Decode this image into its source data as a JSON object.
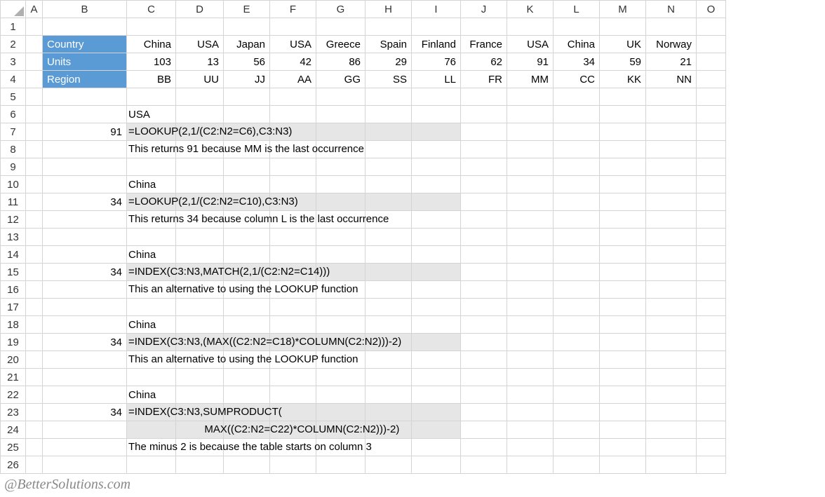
{
  "columns": [
    "A",
    "B",
    "C",
    "D",
    "E",
    "F",
    "G",
    "H",
    "I",
    "J",
    "K",
    "L",
    "M",
    "N",
    "O"
  ],
  "rows": [
    "1",
    "2",
    "3",
    "4",
    "5",
    "6",
    "7",
    "8",
    "9",
    "10",
    "11",
    "12",
    "13",
    "14",
    "15",
    "16",
    "17",
    "18",
    "19",
    "20",
    "21",
    "22",
    "23",
    "24",
    "25",
    "26"
  ],
  "labels": {
    "country": "Country",
    "units": "Units",
    "region": "Region"
  },
  "data": {
    "countries": [
      "China",
      "USA",
      "Japan",
      "USA",
      "Greece",
      "Spain",
      "Finland",
      "France",
      "USA",
      "China",
      "UK",
      "Norway"
    ],
    "units": [
      103,
      13,
      56,
      42,
      86,
      29,
      76,
      62,
      91,
      34,
      59,
      21
    ],
    "regions": [
      "BB",
      "UU",
      "JJ",
      "AA",
      "GG",
      "SS",
      "LL",
      "FR",
      "MM",
      "CC",
      "KK",
      "NN"
    ]
  },
  "ex1": {
    "input": "USA",
    "result": 91,
    "formula": "=LOOKUP(2,1/(C2:N2=C6),C3:N3)",
    "note": "This returns 91 because MM is the last occurrence"
  },
  "ex2": {
    "input": "China",
    "result": 34,
    "formula": "=LOOKUP(2,1/(C2:N2=C10),C3:N3)",
    "note": "This returns 34 because column L is the last occurrence"
  },
  "ex3": {
    "input": "China",
    "result": 34,
    "formula": "=INDEX(C3:N3,MATCH(2,1/(C2:N2=C14)))",
    "note": "This an alternative to using the LOOKUP function"
  },
  "ex4": {
    "input": "China",
    "result": 34,
    "formula": "=INDEX(C3:N3,(MAX((C2:N2=C18)*COLUMN(C2:N2)))-2)",
    "note": "This an alternative to using the LOOKUP function"
  },
  "ex5": {
    "input": "China",
    "result": 34,
    "formula1": "=INDEX(C3:N3,SUMPRODUCT(",
    "formula2": "                          MAX((C2:N2=C22)*COLUMN(C2:N2)))-2)",
    "note": "The minus 2 is because the table starts on column 3"
  },
  "watermark": "@BetterSolutions.com"
}
